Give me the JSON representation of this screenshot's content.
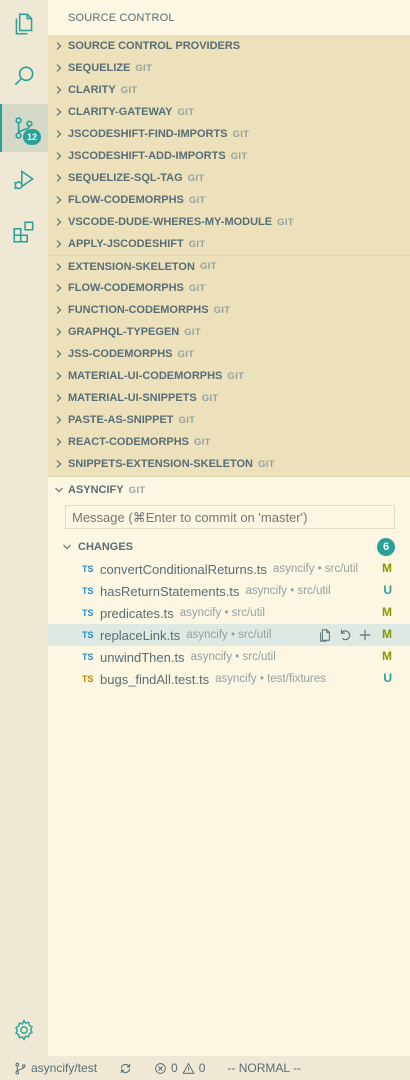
{
  "sidebar": {
    "title": "SOURCE CONTROL"
  },
  "activity_bar": {
    "items": [
      {
        "icon": "files-icon"
      },
      {
        "icon": "search-icon"
      },
      {
        "icon": "source-control-icon",
        "badge": "12",
        "active": true
      },
      {
        "icon": "run-debug-icon"
      },
      {
        "icon": "extensions-icon"
      }
    ]
  },
  "providers": [
    {
      "label": "SOURCE CONTROL PROVIDERS",
      "tag": ""
    },
    {
      "label": "SEQUELIZE",
      "tag": "GIT"
    },
    {
      "label": "CLARITY",
      "tag": "GIT"
    },
    {
      "label": "CLARITY-GATEWAY",
      "tag": "GIT"
    },
    {
      "label": "JSCODESHIFT-FIND-IMPORTS",
      "tag": "GIT"
    },
    {
      "label": "JSCODESHIFT-ADD-IMPORTS",
      "tag": "GIT"
    },
    {
      "label": "SEQUELIZE-SQL-TAG",
      "tag": "GIT"
    },
    {
      "label": "FLOW-CODEMORPHS",
      "tag": "GIT"
    },
    {
      "label": "VSCODE-DUDE-WHERES-MY-MODULE",
      "tag": "GIT"
    },
    {
      "label": "APPLY-JSCODESHIFT",
      "tag": "GIT"
    },
    {
      "label": "EXTENSION-SKELETON",
      "tag": "GIT"
    },
    {
      "label": "FLOW-CODEMORPHS",
      "tag": "GIT"
    },
    {
      "label": "FUNCTION-CODEMORPHS",
      "tag": "GIT"
    },
    {
      "label": "GRAPHQL-TYPEGEN",
      "tag": "GIT"
    },
    {
      "label": "JSS-CODEMORPHS",
      "tag": "GIT"
    },
    {
      "label": "MATERIAL-UI-CODEMORPHS",
      "tag": "GIT"
    },
    {
      "label": "MATERIAL-UI-SNIPPETS",
      "tag": "GIT"
    },
    {
      "label": "PASTE-AS-SNIPPET",
      "tag": "GIT"
    },
    {
      "label": "REACT-CODEMORPHS",
      "tag": "GIT"
    },
    {
      "label": "SNIPPETS-EXTENSION-SKELETON",
      "tag": "GIT"
    },
    {
      "label": "ASYNCIFY",
      "tag": "GIT",
      "expanded": true
    }
  ],
  "commit": {
    "placeholder": "Message (⌘Enter to commit on 'master')"
  },
  "changes": {
    "label": "CHANGES",
    "count": "6",
    "files": [
      {
        "icon": "TS",
        "name": "convertConditionalReturns.ts",
        "desc": "asyncify • src/util",
        "status": "M",
        "test": false
      },
      {
        "icon": "TS",
        "name": "hasReturnStatements.ts",
        "desc": "asyncify • src/util",
        "status": "U",
        "test": false
      },
      {
        "icon": "TS",
        "name": "predicates.ts",
        "desc": "asyncify • src/util",
        "status": "M",
        "test": false
      },
      {
        "icon": "TS",
        "name": "replaceLink.ts",
        "desc": "asyncify • src/util",
        "status": "M",
        "test": false,
        "selected": true
      },
      {
        "icon": "TS",
        "name": "unwindThen.ts",
        "desc": "asyncify • src/util",
        "status": "M",
        "test": false
      },
      {
        "icon": "TS",
        "name": "bugs_findAll.test.ts",
        "desc": "asyncify • test/fixtures",
        "status": "U",
        "test": true
      }
    ]
  },
  "status_bar": {
    "branch": "asyncify/test",
    "errors": "0",
    "warnings": "0",
    "mode": "-- NORMAL --"
  }
}
